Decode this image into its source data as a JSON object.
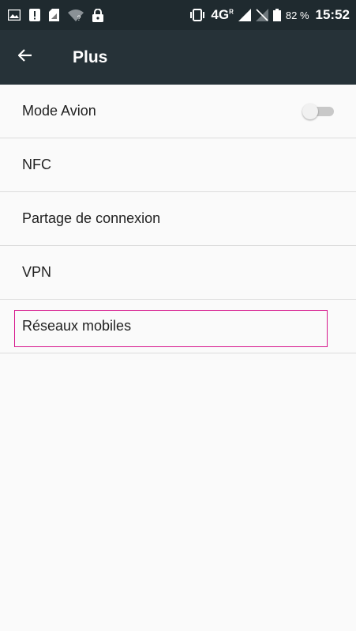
{
  "status_bar": {
    "network": "4G",
    "network_sup": "R",
    "battery_percent": "82 %",
    "time": "15:52",
    "icons": [
      "image-icon",
      "notification-icon",
      "sim-icon",
      "wifi-icon",
      "lock-icon",
      "vibrate-icon",
      "signal-icon",
      "no-signal-icon",
      "battery-icon"
    ]
  },
  "app_bar": {
    "title": "Plus",
    "back_icon": "arrow-left-icon"
  },
  "settings": {
    "items": [
      {
        "label": "Mode Avion",
        "toggle": "off"
      },
      {
        "label": "NFC"
      },
      {
        "label": "Partage de connexion"
      },
      {
        "label": "VPN"
      },
      {
        "label": "Réseaux mobiles"
      }
    ]
  },
  "colors": {
    "status_bar": "#1f2a2f",
    "app_bar": "#263238",
    "background": "#fafafa",
    "highlight": "#d6168c"
  }
}
